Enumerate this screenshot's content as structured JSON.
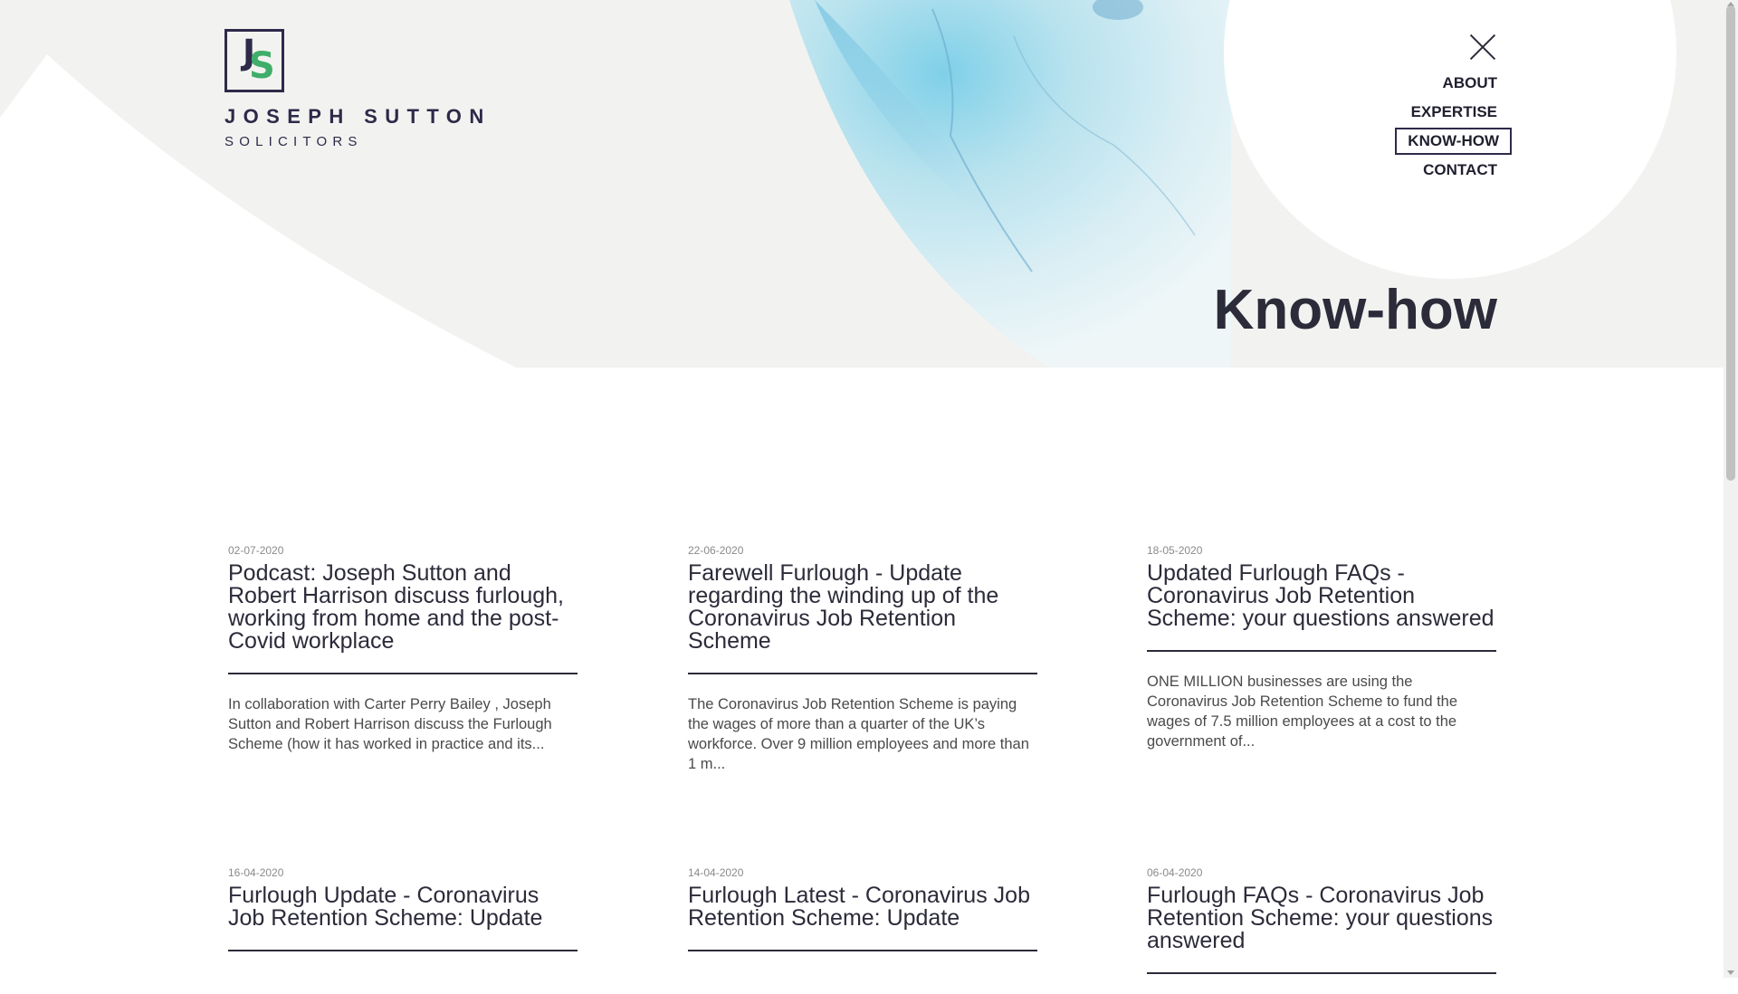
{
  "logo": {
    "mark_j": "J",
    "mark_s": "S",
    "name": "JOSEPH SUTTON",
    "sub": "SOLICITORS"
  },
  "nav": {
    "close_icon": "close-icon",
    "items": [
      {
        "label": "ABOUT",
        "active": false
      },
      {
        "label": "EXPERTISE",
        "active": false
      },
      {
        "label": "KNOW-HOW",
        "active": true
      },
      {
        "label": "CONTACT",
        "active": false
      }
    ]
  },
  "page": {
    "title": "Know-how"
  },
  "articles": [
    {
      "date": "02-07-2020",
      "title": "Podcast: Joseph Sutton and Robert Harrison discuss furlough, working from home and the post-Covid workplace",
      "excerpt": "In collaboration with Carter Perry Bailey , Joseph Sutton and Robert Harrison discuss the Furlough Scheme (how it has worked in practice and its..."
    },
    {
      "date": "22-06-2020",
      "title": "Farewell Furlough - Update regarding the winding up of the Coronavirus Job Retention Scheme",
      "excerpt": "The Coronavirus Job Retention Scheme is paying the wages of more than a quarter of the UK’s workforce.   Over 9 million employees and more than 1 m..."
    },
    {
      "date": "18-05-2020",
      "title": "Updated Furlough FAQs - Coronavirus Job Retention Scheme: your questions answered",
      "excerpt": "ONE MILLION businesses are using the Coronavirus Job Retention Scheme to fund the wages of 7.5 million employees at a cost to the government of..."
    },
    {
      "date": "16-04-2020",
      "title": "Furlough Update - Coronavirus Job Retention Scheme: Update",
      "excerpt": ""
    },
    {
      "date": "14-04-2020",
      "title": "Furlough Latest - Coronavirus Job Retention Scheme: Update",
      "excerpt": ""
    },
    {
      "date": "06-04-2020",
      "title": "Furlough FAQs - Coronavirus Job Retention Scheme: your questions answered",
      "excerpt": ""
    }
  ],
  "colors": {
    "navy": "#2d2a4a",
    "green": "#3fae6a",
    "hero_bg": "#f2f3f0",
    "watercolor": "#9fd3e6"
  }
}
